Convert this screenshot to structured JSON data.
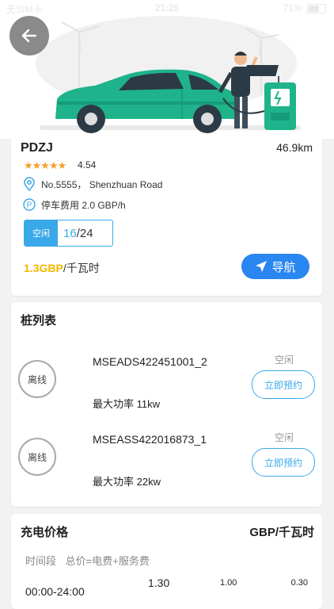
{
  "status_bar": {
    "carrier": "无SIM卡",
    "time": "21:25",
    "battery": "71%"
  },
  "station": {
    "name": "PDZJ",
    "distance": "46.9km",
    "stars": "★★★★★",
    "rating": "4.54",
    "address": "No.5555， Shenzhuan Road",
    "parking_fee": "停车费用 2.0 GBP/h",
    "status_label": "空闲",
    "available": "16",
    "total": "/24",
    "price_value": "1.3GBP",
    "price_unit": "/千瓦时",
    "navigate_label": "导航"
  },
  "piles": {
    "title": "桩列表",
    "items": [
      {
        "state": "离线",
        "code": "MSEADS422451001_2",
        "power": "最大功率 11kw",
        "status": "空闲",
        "action": "立即预约"
      },
      {
        "state": "离线",
        "code": "MSEASS422016873_1",
        "power": "最大功率 22kw",
        "status": "空闲",
        "action": "立即预约"
      }
    ]
  },
  "charging_price": {
    "title": "充电价格",
    "unit": "GBP/千瓦时",
    "col_period": "时间段",
    "col_total": "总价=电费+服务费",
    "rows": [
      {
        "period": "00:00-24:00",
        "total": "1.30",
        "electricity": "1.00",
        "service": "0.30"
      }
    ]
  },
  "colors": {
    "accent": "#3aa8e8",
    "nav": "#2a86f0",
    "price": "#f5b800",
    "car": "#1fb38b"
  },
  "icons": [
    "back-arrow-icon",
    "location-pin-icon",
    "parking-icon",
    "navigate-arrow-icon",
    "wifi-icon",
    "battery-icon"
  ]
}
